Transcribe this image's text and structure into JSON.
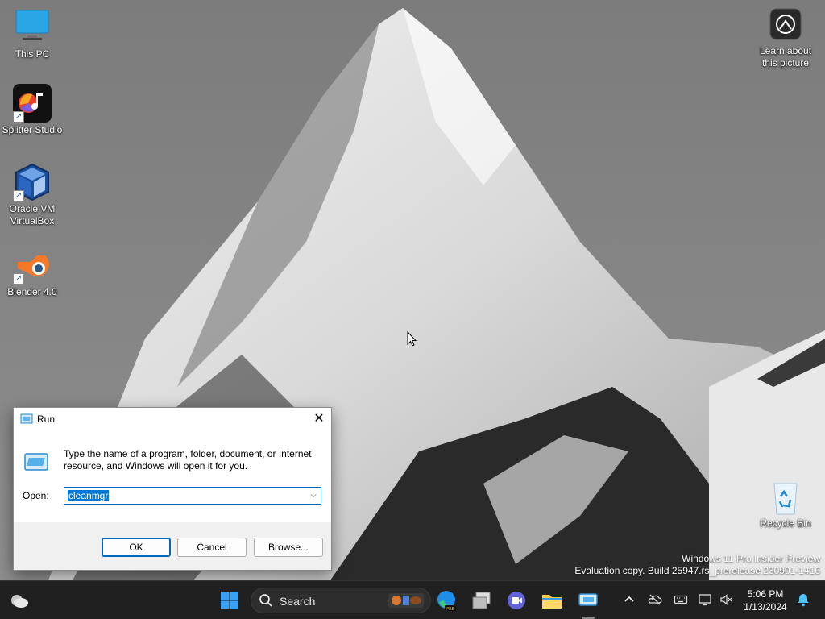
{
  "desktop": {
    "icons": [
      {
        "label": "This PC"
      },
      {
        "label": "Splitter Studio"
      },
      {
        "label": "Oracle VM VirtualBox"
      },
      {
        "label": "Blender 4.0"
      },
      {
        "label": "Learn about this picture"
      },
      {
        "label": "Recycle Bin"
      }
    ],
    "watermark": {
      "line1": "Windows 11 Pro Insider Preview",
      "line2": "Evaluation copy. Build 25947.rs_prerelease.230901-1416"
    }
  },
  "run_dialog": {
    "title": "Run",
    "close_glyph": "✕",
    "description": "Type the name of a program, folder, document, or Internet resource, and Windows will open it for you.",
    "open_label": "Open:",
    "input_value": "cleanmgr",
    "dropdown_glyph": "⌵",
    "ok_label": "OK",
    "cancel_label": "Cancel",
    "browse_label": "Browse..."
  },
  "taskbar": {
    "search_placeholder": "Search",
    "time": "5:06 PM",
    "date": "1/13/2024",
    "accent": "#0078d7"
  }
}
